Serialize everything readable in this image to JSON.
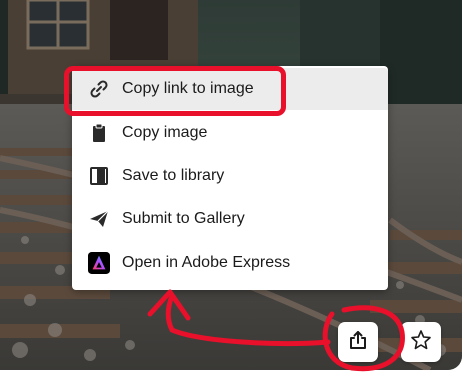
{
  "menu": {
    "items": [
      {
        "label": "Copy link to image",
        "icon": "link-icon"
      },
      {
        "label": "Copy image",
        "icon": "clipboard-icon"
      },
      {
        "label": "Save to library",
        "icon": "library-icon"
      },
      {
        "label": "Submit to Gallery",
        "icon": "paper-plane-icon"
      },
      {
        "label": "Open in Adobe Express",
        "icon": "adobe-express-icon"
      }
    ]
  },
  "actions": {
    "share_icon": "share-icon",
    "favorite_icon": "star-icon"
  },
  "colors": {
    "annotation_red": "#e8102a",
    "menu_hover": "#ececec"
  }
}
